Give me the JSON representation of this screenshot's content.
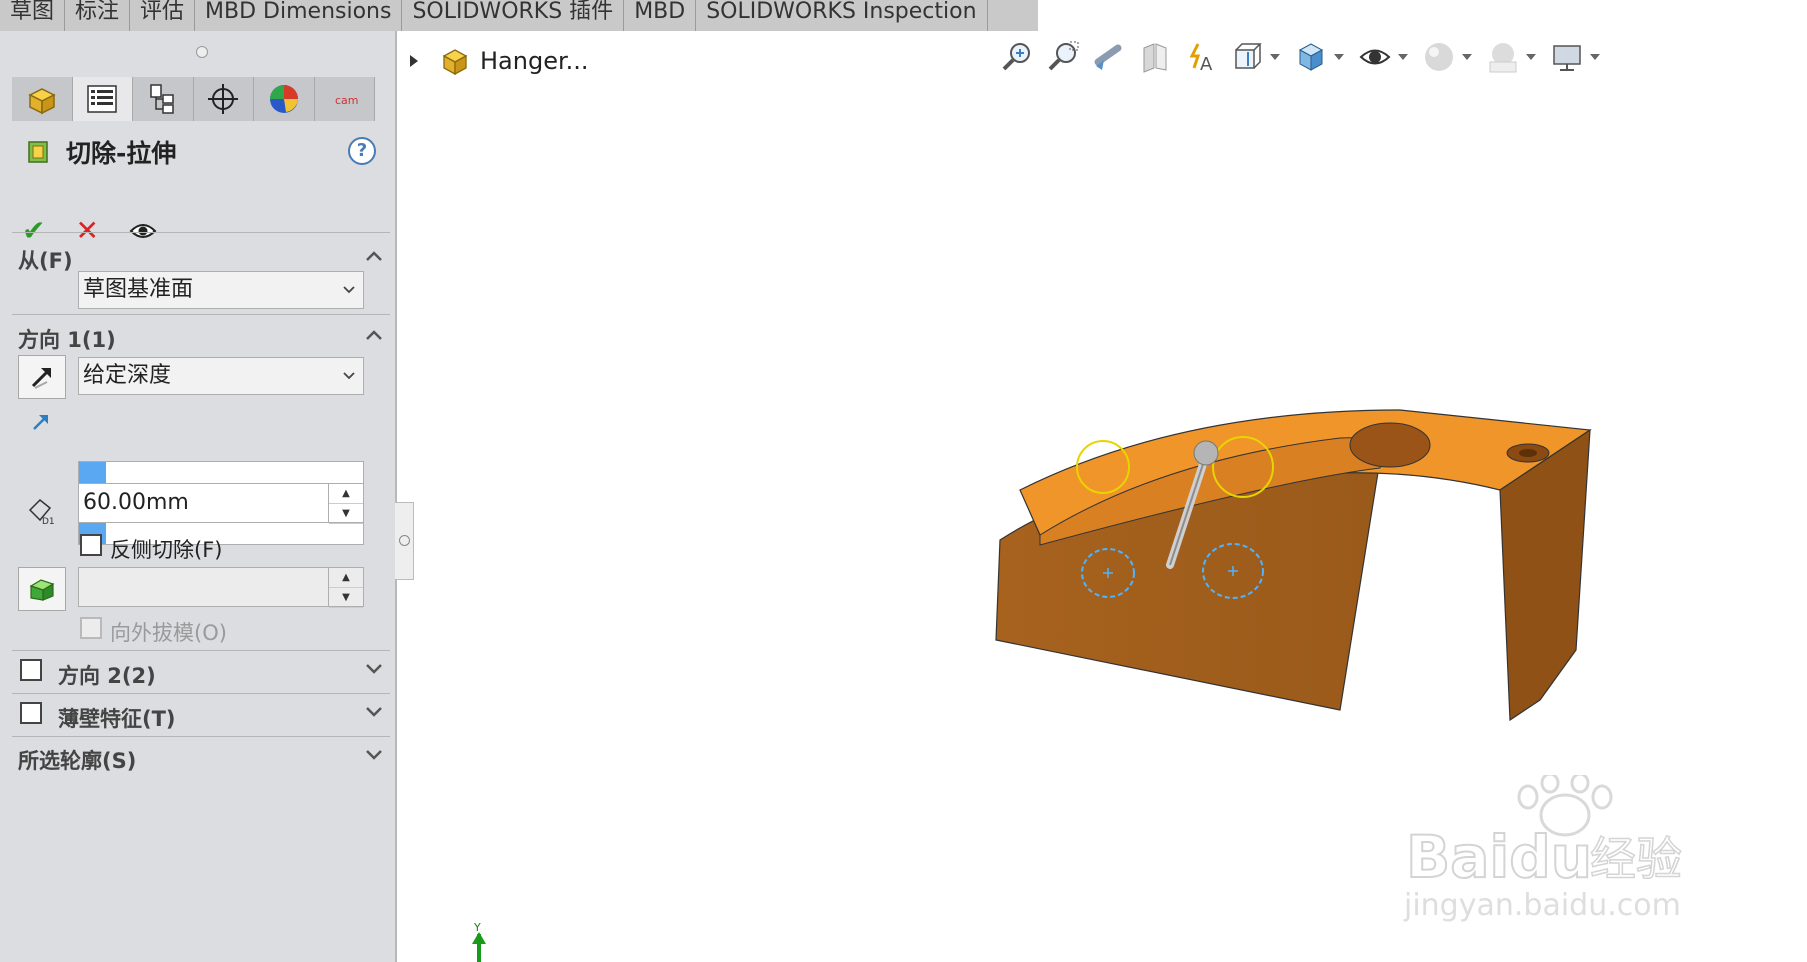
{
  "tabs": [
    "草图",
    "标注",
    "评估",
    "MBD Dimensions",
    "SOLIDWORKS 插件",
    "MBD",
    "SOLIDWORKS Inspection"
  ],
  "property_manager": {
    "icon_tabs": [
      "feature-manager-icon",
      "property-manager-icon",
      "configuration-manager-icon",
      "dimxpert-icon",
      "display-manager-icon",
      "cam-icon"
    ],
    "title": "切除-拉伸",
    "help": "?",
    "from": {
      "label": "从(F)",
      "value": "草图基准面"
    },
    "direction1": {
      "label": "方向 1(1)",
      "end_condition": "给定深度",
      "depth": "60.00mm",
      "flip_side_label": "反侧切除(F)",
      "flip_side_checked": false,
      "draft_value": "",
      "draft_outward_label": "向外拔模(O)"
    },
    "direction2": {
      "label": "方向 2(2)",
      "checked": false
    },
    "thin_feature": {
      "label": "薄壁特征(T)",
      "checked": false
    },
    "selected_contours": {
      "label": "所选轮廓(S)"
    }
  },
  "graphics": {
    "tree_root": "Hanger...",
    "hud_icons": [
      "zoom-to-fit-icon",
      "zoom-to-area-icon",
      "previous-view-icon",
      "section-view-icon",
      "dynamic-annotation-icon",
      "view-orientation-icon",
      "display-style-icon",
      "hide-show-items-icon",
      "edit-appearance-icon",
      "apply-scene-icon",
      "view-settings-icon"
    ],
    "triad_axis": "Y",
    "model_color": "#f0952a"
  },
  "watermark": {
    "brand": "Baidu",
    "brand_cn": "经验",
    "url": "jingyan.baidu.com"
  }
}
